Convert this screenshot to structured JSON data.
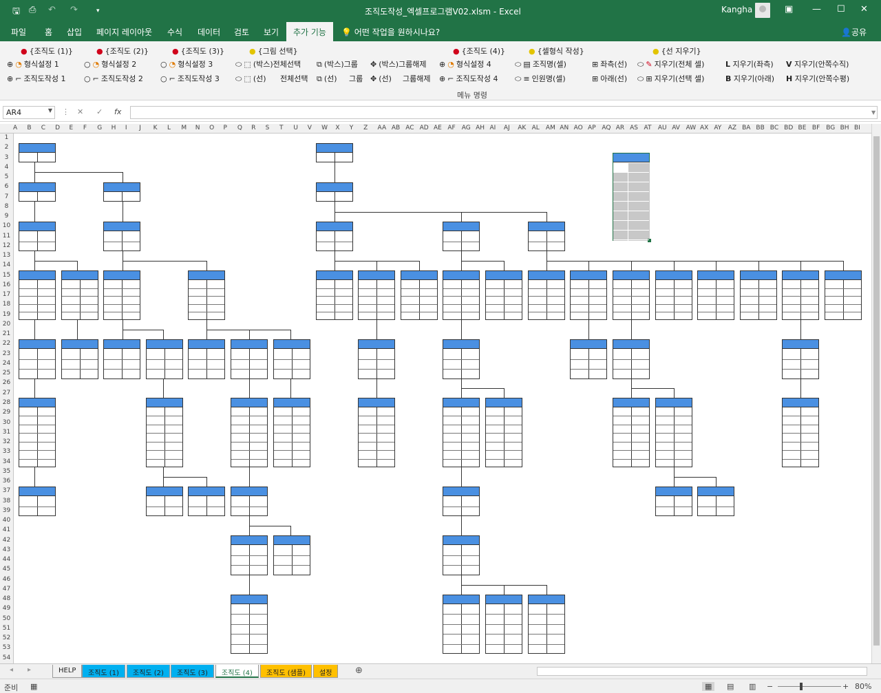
{
  "title": "조직도작성_엑셀프로그램V02.xlsm  -  Excel",
  "user": "Kangha",
  "tabs": [
    "파일",
    "홈",
    "삽입",
    "페이지 레이아웃",
    "수식",
    "데이터",
    "검토",
    "보기",
    "추가 기능"
  ],
  "active_tab": "추가 기능",
  "tell_me": "어떤 작업을 원하시나요?",
  "share": "공유",
  "ribbon": {
    "group_label": "메뉴 명령",
    "headers": [
      "{조직도 (1)}",
      "{조직도 (2)}",
      "{조직도 (3)}",
      "{그림 선택}",
      "{조직도 (4)}",
      "{셀형식 작성}",
      "{선 지우기}"
    ],
    "row1": [
      "형식설정 1",
      "형식설정 2",
      "형식설정 3",
      "(박스)전체선택",
      "(박스)그룹",
      "(박스)그룹해제",
      "형식설정 4",
      "조직명(셀)",
      "좌측(선)",
      "지우기(전체 셀)",
      "지우기(좌측)",
      "지우기(안쪽수직)"
    ],
    "row2": [
      "조직도작성 1",
      "조직도작성 2",
      "조직도작성 3",
      "(선)",
      "전체선택",
      "(선)",
      "그룹",
      "(선)",
      "그룹해제",
      "조직도작성 4",
      "인원명(셀)",
      "아래(선)",
      "지우기(선택 셀)",
      "지우기(아래)",
      "지우기(안쪽수평)"
    ],
    "key_letters": [
      "L",
      "V",
      "B",
      "H"
    ]
  },
  "formula_bar": {
    "name_box": "AR4",
    "formula": ""
  },
  "columns": [
    "A",
    "B",
    "C",
    "D",
    "E",
    "F",
    "G",
    "H",
    "I",
    "J",
    "K",
    "L",
    "M",
    "N",
    "O",
    "P",
    "Q",
    "R",
    "S",
    "T",
    "U",
    "V",
    "W",
    "X",
    "Y",
    "Z",
    "AA",
    "AB",
    "AC",
    "AD",
    "AE",
    "AF",
    "AG",
    "AH",
    "AI",
    "AJ",
    "AK",
    "AL",
    "AM",
    "AN",
    "AO",
    "AP",
    "AQ",
    "AR",
    "AS",
    "AT",
    "AU",
    "AV",
    "AW",
    "AX",
    "AY",
    "AZ",
    "BA",
    "BB",
    "BC",
    "BD",
    "BE",
    "BF",
    "BG",
    "BH",
    "BI"
  ],
  "rows": [
    "1",
    "2",
    "3",
    "4",
    "5",
    "6",
    "7",
    "8",
    "9",
    "10",
    "11",
    "12",
    "13",
    "14",
    "15",
    "16",
    "17",
    "18",
    "19",
    "20",
    "21",
    "22",
    "23",
    "24",
    "25",
    "26",
    "27",
    "28",
    "29",
    "30",
    "31",
    "32",
    "33",
    "34",
    "35",
    "36",
    "37",
    "38",
    "39",
    "40",
    "41",
    "42",
    "43",
    "44",
    "45",
    "46",
    "47",
    "48",
    "49",
    "50",
    "51",
    "52",
    "53",
    "54"
  ],
  "sheet_tabs": [
    {
      "label": "HELP",
      "style": "plain"
    },
    {
      "label": "조직도 (1)",
      "style": "cyan"
    },
    {
      "label": "조직도 (2)",
      "style": "cyan"
    },
    {
      "label": "조직도 (3)",
      "style": "cyan"
    },
    {
      "label": "조직도 (4)",
      "style": "active"
    },
    {
      "label": "조직도 (샘플)",
      "style": "yellow"
    },
    {
      "label": "설정",
      "style": "yellow"
    }
  ],
  "status": {
    "ready": "준비",
    "zoom": "80%"
  },
  "colors": {
    "excel_green": "#217346",
    "box_header": "#4a90e2",
    "tab_cyan": "#00b0f0",
    "tab_yellow": "#ffc000"
  }
}
